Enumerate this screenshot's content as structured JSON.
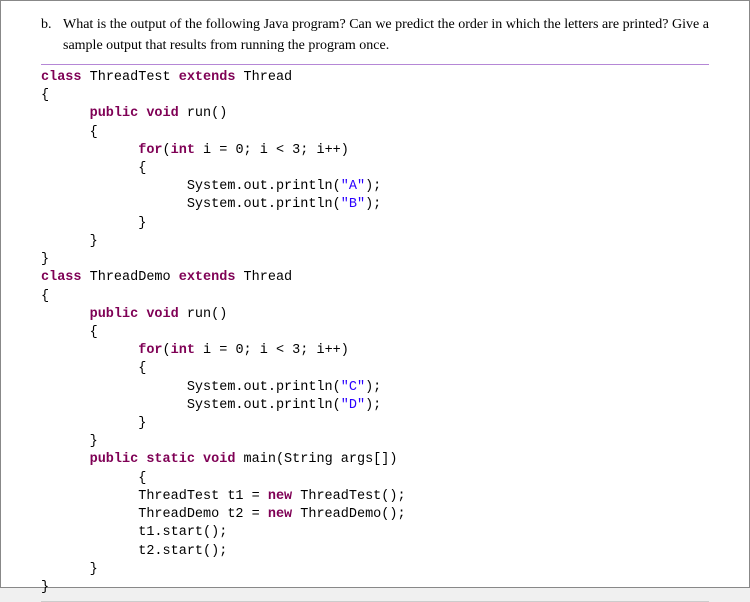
{
  "question": {
    "label": "b.",
    "text": "What is the output of the following Java program? Can we predict the order in which the letters are printed? Give a sample output that results from running the program once."
  },
  "code": {
    "kw_class1": "class",
    "name_ThreadTest": " ThreadTest ",
    "kw_extends1": "extends",
    "name_Thread1": " Thread",
    "brace_open1": "{",
    "indent1": "      ",
    "kw_public1": "public",
    "kw_void1": " void",
    "mname_run1": " run()",
    "brace_open2": "      {",
    "indent2": "            ",
    "kw_for1": "for",
    "for_head1": "(",
    "kw_int1": "int",
    "for_rest1": " i = 0; i < 3; i++)",
    "brace_open3": "            {",
    "indent3": "                  ",
    "sys1": "System.out.println(",
    "strA": "\"A\"",
    "semi1": ");",
    "sys2": "System.out.println(",
    "strB": "\"B\"",
    "semi2": ");",
    "brace_close3": "            }",
    "brace_close2": "      }",
    "brace_close1": "}",
    "kw_class2": "class",
    "name_ThreadDemo": " ThreadDemo ",
    "kw_extends2": "extends",
    "name_Thread2": " Thread",
    "brace_open4": "{",
    "kw_public2": "public",
    "kw_void2": " void",
    "mname_run2": " run()",
    "brace_open5": "      {",
    "kw_for2": "for",
    "for_head2": "(",
    "kw_int2": "int",
    "for_rest2": " i = 0; i < 3; i++)",
    "brace_open6": "            {",
    "sys3": "System.out.println(",
    "strC": "\"C\"",
    "semi3": ");",
    "sys4": "System.out.println(",
    "strD": "\"D\"",
    "semi4": ");",
    "brace_close6": "            }",
    "brace_close5": "      }",
    "kw_public3": "public",
    "kw_static": " static",
    "kw_void3": " void",
    "mname_main": " main(String args[])",
    "brace_open7": "            {",
    "indent4": "            ",
    "line_t1": "ThreadTest t1 = ",
    "kw_new1": "new",
    "ctor1": " ThreadTest();",
    "line_t2": "ThreadDemo t2 = ",
    "kw_new2": "new",
    "ctor2": " ThreadDemo();",
    "start1": "t1.start();",
    "start2": "t2.start();",
    "brace_close7": "      }",
    "brace_close4": "}"
  }
}
